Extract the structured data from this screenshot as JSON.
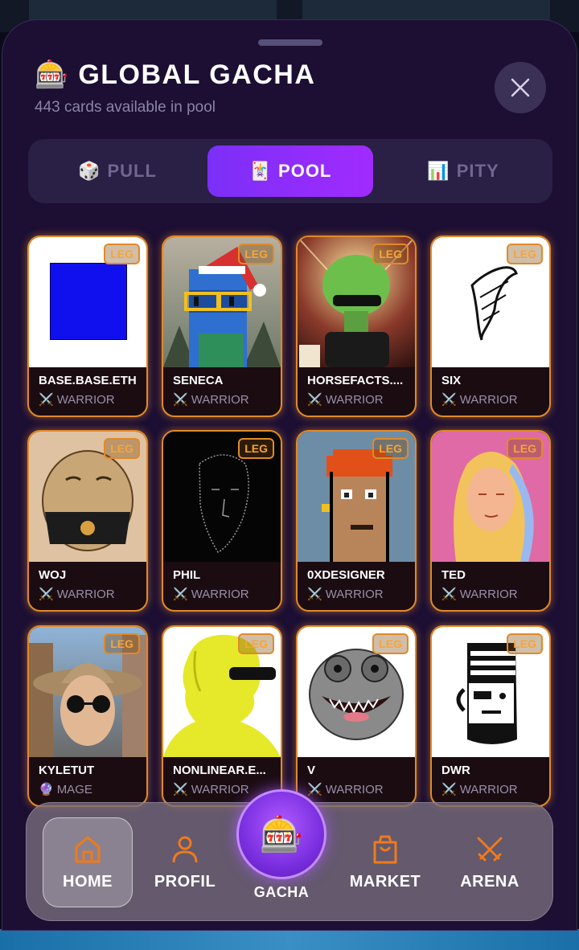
{
  "header": {
    "title_icon": "🎰",
    "title": "GLOBAL GACHA",
    "subtitle": "443 cards available in pool"
  },
  "tabs": [
    {
      "icon": "🎲",
      "label": "PULL"
    },
    {
      "icon": "🃏",
      "label": "POOL"
    },
    {
      "icon": "📊",
      "label": "PITY"
    }
  ],
  "active_tab": "POOL",
  "cards": [
    {
      "name": "BASE.BASE.ETH",
      "badge": "LEG",
      "class_icon": "⚔️",
      "class": "WARRIOR"
    },
    {
      "name": "SENECA",
      "badge": "LEG",
      "class_icon": "⚔️",
      "class": "WARRIOR"
    },
    {
      "name": "HORSEFACTS....",
      "badge": "LEG",
      "class_icon": "⚔️",
      "class": "WARRIOR"
    },
    {
      "name": "SIX",
      "badge": "LEG",
      "class_icon": "⚔️",
      "class": "WARRIOR"
    },
    {
      "name": "WOJ",
      "badge": "LEG",
      "class_icon": "⚔️",
      "class": "WARRIOR"
    },
    {
      "name": "PHIL",
      "badge": "LEG",
      "class_icon": "⚔️",
      "class": "WARRIOR"
    },
    {
      "name": "0XDESIGNER",
      "badge": "LEG",
      "class_icon": "⚔️",
      "class": "WARRIOR"
    },
    {
      "name": "TED",
      "badge": "LEG",
      "class_icon": "⚔️",
      "class": "WARRIOR"
    },
    {
      "name": "KYLETUT",
      "badge": "LEG",
      "class_icon": "🔮",
      "class": "MAGE"
    },
    {
      "name": "NONLINEAR.E...",
      "badge": "LEG",
      "class_icon": "⚔️",
      "class": "WARRIOR"
    },
    {
      "name": "V",
      "badge": "LEG",
      "class_icon": "⚔️",
      "class": "WARRIOR"
    },
    {
      "name": "DWR",
      "badge": "LEG",
      "class_icon": "⚔️",
      "class": "WARRIOR"
    }
  ],
  "nav": {
    "home": "HOME",
    "profil": "PROFIL",
    "gacha_icon": "🎰",
    "gacha": "GACHA",
    "market": "MARKET",
    "arena": "ARENA"
  },
  "colors": {
    "accent": "#8a2eff",
    "legendary": "#e08a2a",
    "nav_icon": "#f07a1a"
  }
}
